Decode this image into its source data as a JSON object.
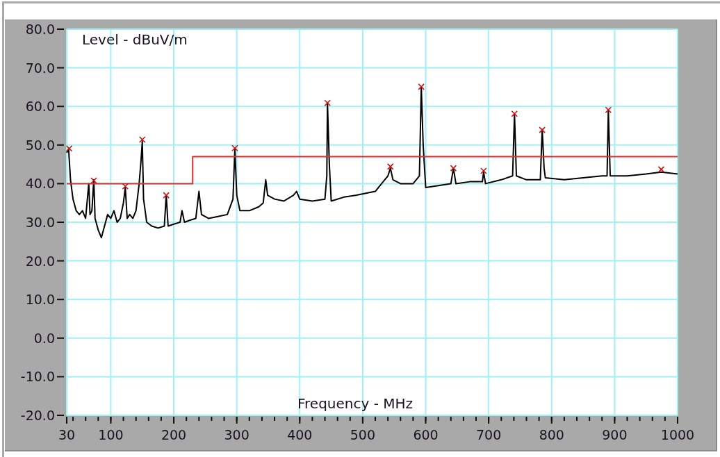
{
  "graph": {
    "chart_data": {
      "type": "line",
      "grid": true,
      "xlabel": "Frequency - MHz",
      "ylabel": "Level - dBuV/m",
      "xlim": [
        30,
        1000
      ],
      "ylim": [
        -20,
        80
      ],
      "xticks": [
        30,
        100,
        200,
        300,
        400,
        500,
        600,
        700,
        800,
        900,
        1000
      ],
      "yticks": [
        {
          "value": 80,
          "label": "80.0"
        },
        {
          "value": 70,
          "label": "70.0"
        },
        {
          "value": 60,
          "label": "60.0"
        },
        {
          "value": 50,
          "label": "50.0"
        },
        {
          "value": 40,
          "label": "40.0"
        },
        {
          "value": 30,
          "label": "30.0"
        },
        {
          "value": 20,
          "label": "20.0"
        },
        {
          "value": 10,
          "label": "10.0"
        },
        {
          "value": 0,
          "label": "0.0"
        },
        {
          "value": -10,
          "label": "-10.0"
        },
        {
          "value": -20,
          "label": "-20.0"
        }
      ],
      "series": [
        {
          "color": "#000000",
          "x": [
            30,
            33,
            36,
            40,
            45,
            50,
            55,
            60,
            65,
            67,
            70,
            73,
            75,
            80,
            85,
            90,
            95,
            100,
            105,
            110,
            115,
            120,
            123,
            126,
            130,
            135,
            140,
            145,
            148,
            150,
            152,
            157,
            165,
            175,
            185,
            188,
            191,
            200,
            210,
            213,
            217,
            225,
            235,
            240,
            244,
            255,
            270,
            285,
            294,
            297,
            300,
            305,
            320,
            335,
            342,
            346,
            349,
            360,
            375,
            390,
            395,
            400,
            420,
            440,
            443,
            444,
            447,
            450,
            470,
            490,
            505,
            520,
            530,
            540,
            544,
            548,
            560,
            580,
            590,
            593,
            596,
            600,
            620,
            640,
            644,
            648,
            670,
            690,
            692,
            695,
            720,
            738,
            741,
            744,
            760,
            782,
            785,
            788,
            790,
            820,
            850,
            880,
            888,
            890,
            893,
            920,
            950,
            974,
            1000
          ],
          "values": [
            48,
            49,
            41,
            36,
            33,
            32,
            33,
            31,
            40,
            32,
            33,
            41,
            31,
            28,
            26,
            29,
            32,
            31,
            33,
            30,
            31,
            35,
            39,
            31,
            32,
            31,
            33,
            40,
            46,
            51,
            36,
            30,
            29,
            28.5,
            29,
            37,
            29,
            29.5,
            30,
            33,
            30,
            30.5,
            31,
            38,
            32,
            31,
            31.5,
            32,
            36,
            49,
            37,
            33,
            33,
            34,
            35,
            41,
            37,
            36,
            35.5,
            37,
            38,
            36,
            35.5,
            36,
            42,
            61,
            45,
            35.5,
            36.5,
            37,
            37.5,
            38,
            40,
            42,
            44,
            41,
            40,
            40,
            42,
            65,
            50,
            39,
            39.5,
            40,
            44,
            40,
            40.5,
            40.5,
            43,
            40,
            41,
            42,
            58,
            42,
            41,
            41,
            54,
            44,
            41.5,
            41,
            41.5,
            42,
            42,
            59,
            42,
            42,
            42.5,
            43,
            42.5
          ]
        },
        {
          "color": "#d9302c",
          "x": [
            30,
            230,
            230,
            1000
          ],
          "values": [
            40,
            40,
            47,
            47
          ]
        },
        {
          "type": "scatter",
          "marker": "x",
          "color": "#cc1111",
          "x": [
            34,
            73,
            123,
            150,
            188,
            297,
            444,
            544,
            593,
            644,
            692,
            741,
            785,
            890,
            974
          ],
          "values": [
            49.1,
            40.8,
            39.3,
            51.4,
            37,
            49.2,
            60.9,
            44.4,
            65.1,
            44,
            43.3,
            58.1,
            53.9,
            59.1,
            43.7
          ]
        }
      ]
    }
  }
}
